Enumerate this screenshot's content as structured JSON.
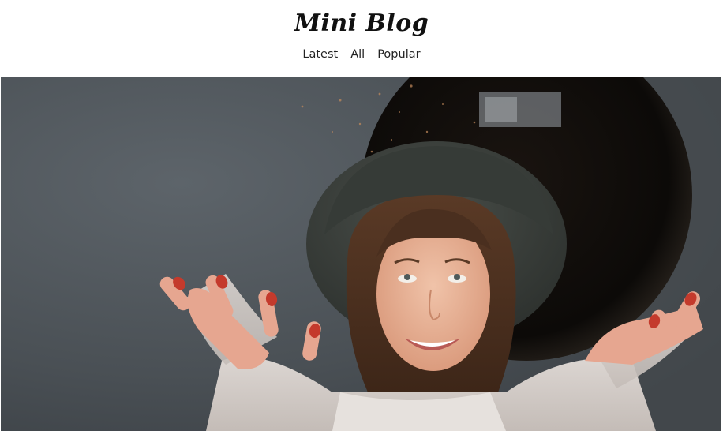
{
  "brand": {
    "title": "Mini Blog"
  },
  "nav": {
    "items": [
      {
        "label": "Latest",
        "active": false
      },
      {
        "label": "All",
        "active": true
      },
      {
        "label": "Popular",
        "active": false
      }
    ]
  },
  "hero": {
    "image": "photo-woman-in-hat"
  },
  "colors": {
    "text": "#222222",
    "background": "#ffffff",
    "wall": "#4b5156"
  }
}
